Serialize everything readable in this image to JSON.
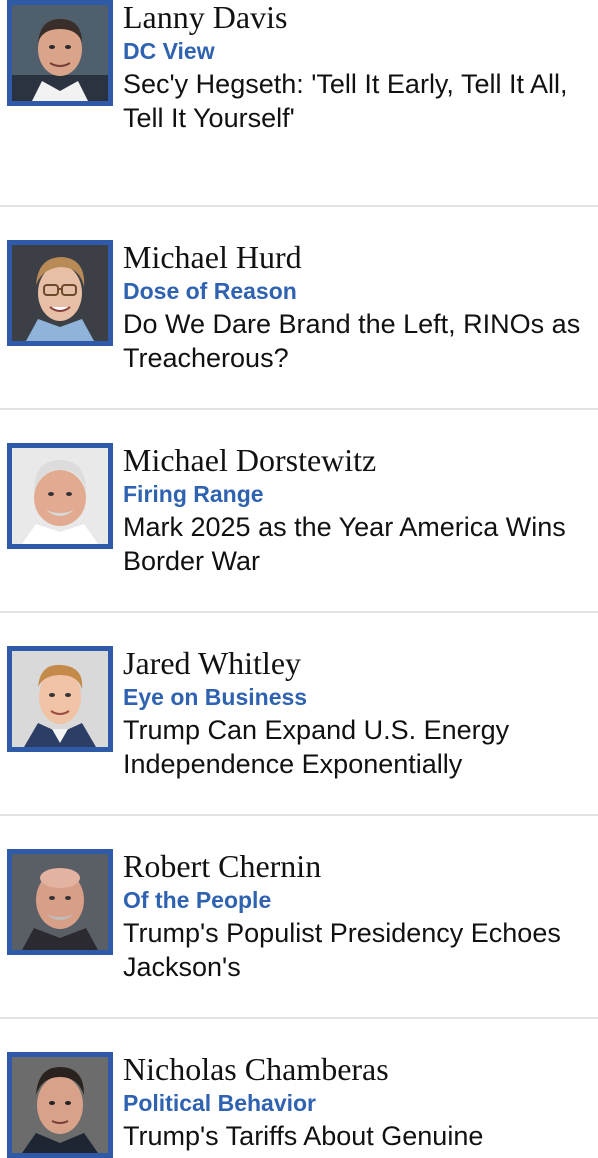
{
  "columnists": [
    {
      "author": "Lanny Davis",
      "column": "DC View",
      "headline": "Sec'y Hegseth: 'Tell It Early, Tell It All, Tell It Yourself'"
    },
    {
      "author": "Michael Hurd",
      "column": "Dose of Reason",
      "headline": "Do We Dare Brand the Left, RINOs as Treacherous?"
    },
    {
      "author": "Michael Dorstewitz",
      "column": "Firing Range",
      "headline": "Mark 2025 as the Year America Wins Border War"
    },
    {
      "author": "Jared Whitley",
      "column": "Eye on Business",
      "headline": "Trump Can Expand U.S. Energy Independence Exponentially"
    },
    {
      "author": "Robert Chernin",
      "column": "Of the People",
      "headline": "Trump's Populist Presidency Echoes Jackson's"
    },
    {
      "author": "Nicholas Chamberas",
      "column": "Political Behavior",
      "headline": "Trump's Tariffs About Genuine"
    }
  ],
  "colors": {
    "photo_frame": "#2f5aa8",
    "column_label": "#2f62b0",
    "text": "#111111",
    "divider": "#e2e2e2"
  }
}
